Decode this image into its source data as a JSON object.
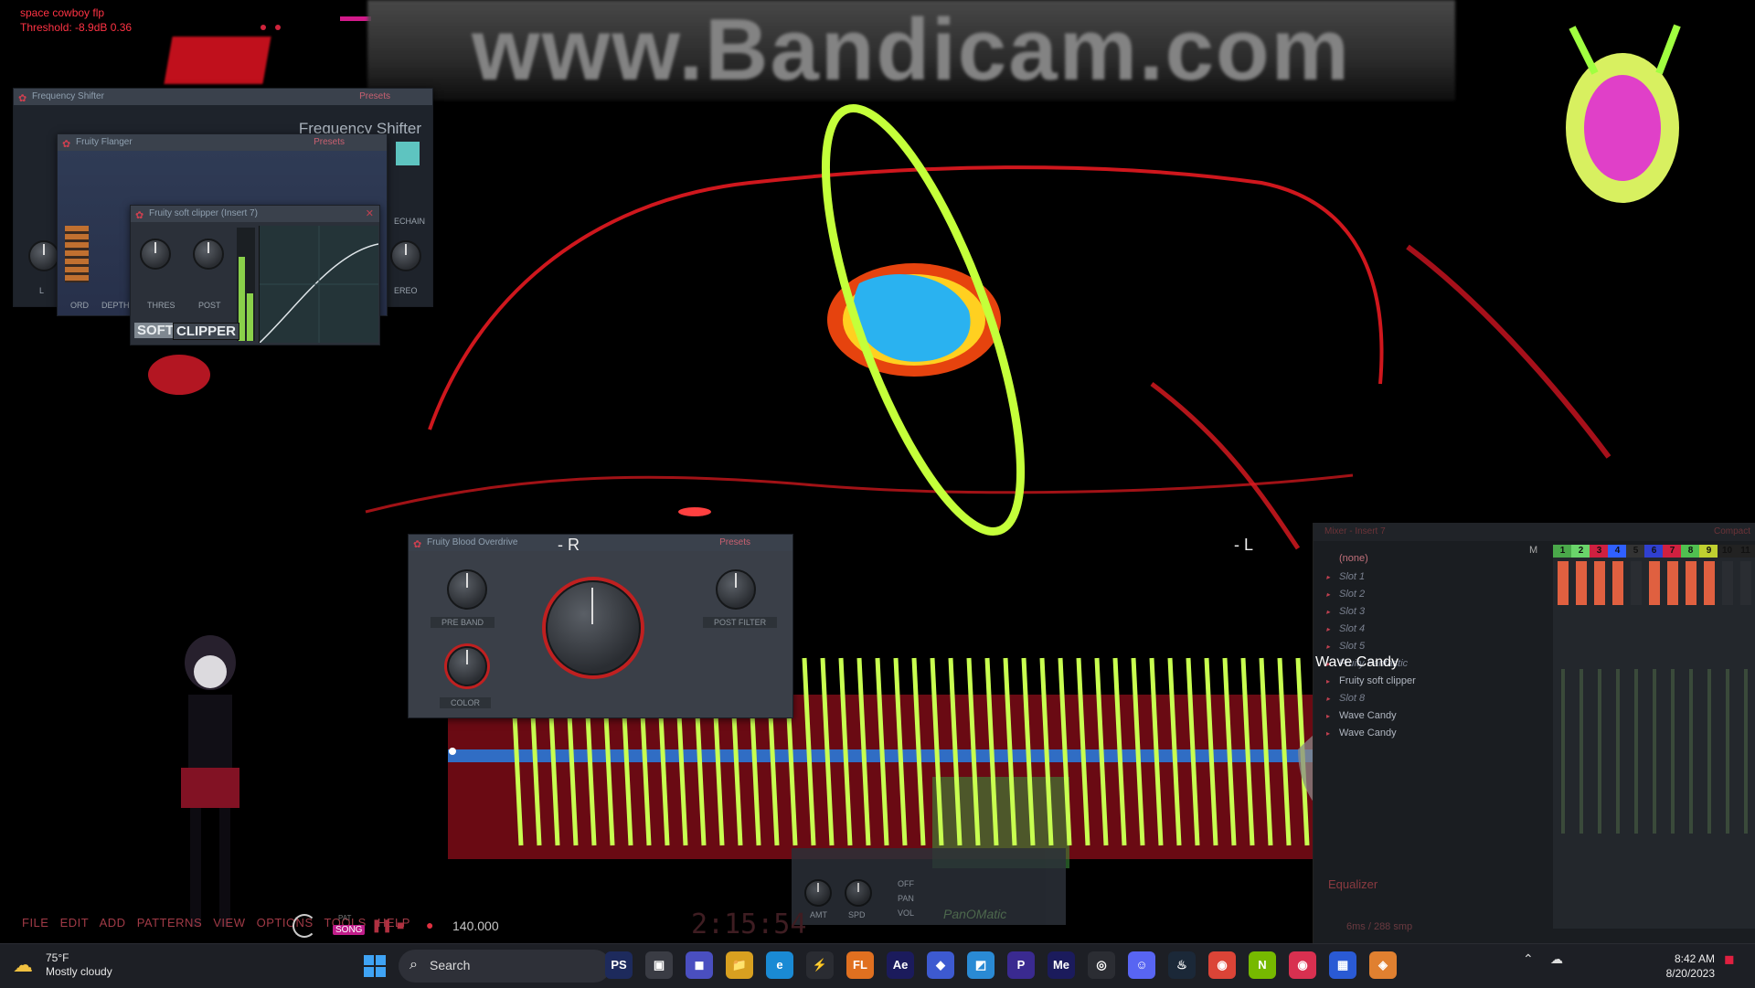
{
  "hud": {
    "line1": "space cowboy flp",
    "line2": "Threshold: -8.9dB  0.36"
  },
  "watermark": "www.Bandicam.com",
  "frequency_shifter": {
    "title": "Frequency Shifter",
    "bar_label": "Frequency Shifter",
    "presets": "Presets",
    "knob_labels": [
      "L",
      "ORD",
      "DEPTH",
      "ECHAIN",
      "EREO"
    ]
  },
  "flanger": {
    "bar_label": "Fruity Flanger",
    "presets": "Presets"
  },
  "soft_clipper": {
    "bar_label": "Fruity soft clipper (Insert 7)",
    "knob1": "THRES",
    "knob2": "POST",
    "soft": "SOFT",
    "clipper": "CLIPPER"
  },
  "blood_overdrive": {
    "bar_label": "Fruity Blood Overdrive",
    "presets": "Presets",
    "pre_band": "PRE BAND",
    "post_filter": "POST FILTER",
    "color": "COLOR"
  },
  "channel_labels": {
    "right": "- R",
    "left": "- L"
  },
  "wave_candy_title": "Wave Candy",
  "mixer": {
    "title": "Mixer - Insert 7",
    "none": "(none)",
    "slots": [
      {
        "label": "Slot 1",
        "active": false
      },
      {
        "label": "Slot 2",
        "active": false
      },
      {
        "label": "Slot 3",
        "active": false
      },
      {
        "label": "Slot 4",
        "active": false
      },
      {
        "label": "Slot 5",
        "active": false
      },
      {
        "label": "Fruity Fantastic",
        "active": false
      },
      {
        "label": "Fruity soft clipper",
        "active": true
      },
      {
        "label": "Slot 8",
        "active": false
      },
      {
        "label": "Wave Candy",
        "active": true
      },
      {
        "label": "Wave Candy",
        "active": true
      }
    ],
    "header_m": "M",
    "channels": [
      "1",
      "2",
      "3",
      "4",
      "5",
      "6",
      "7",
      "8",
      "9",
      "10",
      "11"
    ],
    "channel_colors": [
      "#4aa84a",
      "#6ad46a",
      "#d02040",
      "#3060ff",
      "#333333",
      "#3040d0",
      "#d02040",
      "#50c050",
      "#c0d030",
      "#222222",
      "#222222"
    ],
    "equalizer": "Equalizer",
    "cpu": "6ms / 288 smp",
    "compact": "Compact"
  },
  "menu": [
    "FILE",
    "EDIT",
    "ADD",
    "PATTERNS",
    "VIEW",
    "OPTIONS",
    "TOOLS",
    "HELP"
  ],
  "transport": {
    "pat": "PAT",
    "song": "SONG",
    "tempo": "140.000",
    "time": "2:15:54"
  },
  "fruity_mini": {
    "amt": "AMT",
    "spd": "SPD",
    "off": "OFF",
    "pan": "PAN",
    "vol": "VOL",
    "brand": "PanOMatic"
  },
  "taskbar": {
    "temperature": "75°F",
    "condition": "Mostly cloudy",
    "search": "Search",
    "time": "8:42 AM",
    "date": "8/20/2023",
    "apps": [
      {
        "name": "PS",
        "color": "#1d2a5c"
      },
      {
        "name": "▣",
        "color": "#3a3c44"
      },
      {
        "name": "◼",
        "color": "#4a4fc0"
      },
      {
        "name": "📁",
        "color": "#d8a020"
      },
      {
        "name": "e",
        "color": "#1a8ad4"
      },
      {
        "name": "⚡",
        "color": "#2a2c32"
      },
      {
        "name": "FL",
        "color": "#e07020"
      },
      {
        "name": "Ae",
        "color": "#1b1b5c"
      },
      {
        "name": "◆",
        "color": "#3d5ad0"
      },
      {
        "name": "◩",
        "color": "#2a8ad4"
      },
      {
        "name": "P",
        "color": "#3a2a90"
      },
      {
        "name": "Me",
        "color": "#1b1b5c"
      },
      {
        "name": "◎",
        "color": "#2b2d33"
      },
      {
        "name": "☺",
        "color": "#5865f2"
      },
      {
        "name": "♨",
        "color": "#1b2838"
      },
      {
        "name": "◉",
        "color": "#db4437"
      },
      {
        "name": "N",
        "color": "#76b900"
      },
      {
        "name": "◉",
        "color": "#d83050"
      },
      {
        "name": "▦",
        "color": "#2a5ad4"
      },
      {
        "name": "◈",
        "color": "#e08030"
      }
    ]
  }
}
